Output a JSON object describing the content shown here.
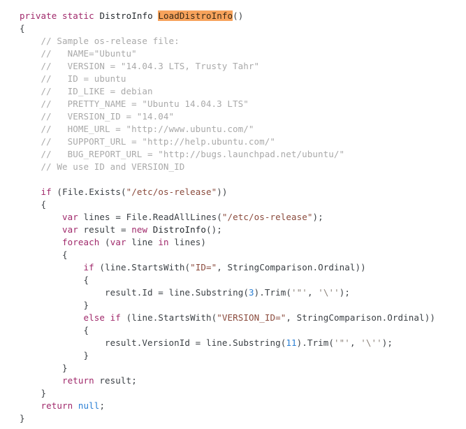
{
  "editor": {
    "language": "csharp",
    "background_color": "#ffffff",
    "highlight_color": "#f7a35c",
    "keyword_color": "#a0296b",
    "string_color": "#8a4a3c",
    "number_color": "#2a7fd4",
    "comment_color": "#a9a9a9",
    "text_color": "#3b4045",
    "search_highlight_term": "LoadDistroInfo"
  },
  "code": {
    "lines": [
      {
        "id": "l1",
        "indent": 0,
        "tokens": [
          {
            "t": "kw",
            "v": "private"
          },
          {
            "t": "plain",
            "v": " "
          },
          {
            "t": "kw",
            "v": "static"
          },
          {
            "t": "plain",
            "v": " "
          },
          {
            "t": "type",
            "v": "DistroInfo"
          },
          {
            "t": "plain",
            "v": " "
          },
          {
            "t": "hl",
            "v": "LoadDistroInfo"
          },
          {
            "t": "punc",
            "v": "()"
          }
        ]
      },
      {
        "id": "l2",
        "indent": 0,
        "tokens": [
          {
            "t": "punc",
            "v": "{"
          }
        ]
      },
      {
        "id": "l3",
        "indent": 1,
        "tokens": [
          {
            "t": "cmt",
            "v": "// Sample os-release file:"
          }
        ]
      },
      {
        "id": "l4",
        "indent": 1,
        "tokens": [
          {
            "t": "cmt",
            "v": "//   NAME=\"Ubuntu\""
          }
        ]
      },
      {
        "id": "l5",
        "indent": 1,
        "tokens": [
          {
            "t": "cmt",
            "v": "//   VERSION = \"14.04.3 LTS, Trusty Tahr\""
          }
        ]
      },
      {
        "id": "l6",
        "indent": 1,
        "tokens": [
          {
            "t": "cmt",
            "v": "//   ID = ubuntu"
          }
        ]
      },
      {
        "id": "l7",
        "indent": 1,
        "tokens": [
          {
            "t": "cmt",
            "v": "//   ID_LIKE = debian"
          }
        ]
      },
      {
        "id": "l8",
        "indent": 1,
        "tokens": [
          {
            "t": "cmt",
            "v": "//   PRETTY_NAME = \"Ubuntu 14.04.3 LTS\""
          }
        ]
      },
      {
        "id": "l9",
        "indent": 1,
        "tokens": [
          {
            "t": "cmt",
            "v": "//   VERSION_ID = \"14.04\""
          }
        ]
      },
      {
        "id": "l10",
        "indent": 1,
        "tokens": [
          {
            "t": "cmt",
            "v": "//   HOME_URL = \"http://www.ubuntu.com/\""
          }
        ]
      },
      {
        "id": "l11",
        "indent": 1,
        "tokens": [
          {
            "t": "cmt",
            "v": "//   SUPPORT_URL = \"http://help.ubuntu.com/\""
          }
        ]
      },
      {
        "id": "l12",
        "indent": 1,
        "tokens": [
          {
            "t": "cmt",
            "v": "//   BUG_REPORT_URL = \"http://bugs.launchpad.net/ubuntu/\""
          }
        ]
      },
      {
        "id": "l13",
        "indent": 1,
        "tokens": [
          {
            "t": "cmt",
            "v": "// We use ID and VERSION_ID"
          }
        ]
      },
      {
        "id": "l14",
        "indent": 0,
        "tokens": []
      },
      {
        "id": "l15",
        "indent": 1,
        "tokens": [
          {
            "t": "kw",
            "v": "if"
          },
          {
            "t": "plain",
            "v": " "
          },
          {
            "t": "punc",
            "v": "("
          },
          {
            "t": "ident",
            "v": "File.Exists"
          },
          {
            "t": "punc",
            "v": "("
          },
          {
            "t": "str",
            "v": "\"/etc/os-release\""
          },
          {
            "t": "punc",
            "v": "))"
          }
        ]
      },
      {
        "id": "l16",
        "indent": 1,
        "tokens": [
          {
            "t": "punc",
            "v": "{"
          }
        ]
      },
      {
        "id": "l17",
        "indent": 2,
        "tokens": [
          {
            "t": "kw",
            "v": "var"
          },
          {
            "t": "plain",
            "v": " "
          },
          {
            "t": "ident",
            "v": "lines"
          },
          {
            "t": "plain",
            "v": " "
          },
          {
            "t": "punc",
            "v": "="
          },
          {
            "t": "plain",
            "v": " "
          },
          {
            "t": "ident",
            "v": "File.ReadAllLines"
          },
          {
            "t": "punc",
            "v": "("
          },
          {
            "t": "str",
            "v": "\"/etc/os-release\""
          },
          {
            "t": "punc",
            "v": ");"
          }
        ]
      },
      {
        "id": "l18",
        "indent": 2,
        "tokens": [
          {
            "t": "kw",
            "v": "var"
          },
          {
            "t": "plain",
            "v": " "
          },
          {
            "t": "ident",
            "v": "result"
          },
          {
            "t": "plain",
            "v": " "
          },
          {
            "t": "punc",
            "v": "="
          },
          {
            "t": "plain",
            "v": " "
          },
          {
            "t": "kw",
            "v": "new"
          },
          {
            "t": "plain",
            "v": " "
          },
          {
            "t": "type",
            "v": "DistroInfo"
          },
          {
            "t": "punc",
            "v": "();"
          }
        ]
      },
      {
        "id": "l19",
        "indent": 2,
        "tokens": [
          {
            "t": "kw",
            "v": "foreach"
          },
          {
            "t": "plain",
            "v": " "
          },
          {
            "t": "punc",
            "v": "("
          },
          {
            "t": "kw",
            "v": "var"
          },
          {
            "t": "plain",
            "v": " "
          },
          {
            "t": "ident",
            "v": "line"
          },
          {
            "t": "plain",
            "v": " "
          },
          {
            "t": "kw",
            "v": "in"
          },
          {
            "t": "plain",
            "v": " "
          },
          {
            "t": "ident",
            "v": "lines"
          },
          {
            "t": "punc",
            "v": ")"
          }
        ]
      },
      {
        "id": "l20",
        "indent": 2,
        "tokens": [
          {
            "t": "punc",
            "v": "{"
          }
        ]
      },
      {
        "id": "l21",
        "indent": 3,
        "tokens": [
          {
            "t": "kw",
            "v": "if"
          },
          {
            "t": "plain",
            "v": " "
          },
          {
            "t": "punc",
            "v": "("
          },
          {
            "t": "ident",
            "v": "line.StartsWith"
          },
          {
            "t": "punc",
            "v": "("
          },
          {
            "t": "str",
            "v": "\"ID=\""
          },
          {
            "t": "punc",
            "v": ","
          },
          {
            "t": "plain",
            "v": " "
          },
          {
            "t": "ident",
            "v": "StringComparison.Ordinal"
          },
          {
            "t": "punc",
            "v": "))"
          }
        ]
      },
      {
        "id": "l22",
        "indent": 3,
        "tokens": [
          {
            "t": "punc",
            "v": "{"
          }
        ]
      },
      {
        "id": "l23",
        "indent": 4,
        "tokens": [
          {
            "t": "ident",
            "v": "result.Id"
          },
          {
            "t": "plain",
            "v": " "
          },
          {
            "t": "punc",
            "v": "="
          },
          {
            "t": "plain",
            "v": " "
          },
          {
            "t": "ident",
            "v": "line.Substring"
          },
          {
            "t": "punc",
            "v": "("
          },
          {
            "t": "num",
            "v": "3"
          },
          {
            "t": "punc",
            "v": ")."
          },
          {
            "t": "ident",
            "v": "Trim"
          },
          {
            "t": "punc",
            "v": "("
          },
          {
            "t": "chr",
            "v": "'\"'"
          },
          {
            "t": "punc",
            "v": ","
          },
          {
            "t": "plain",
            "v": " "
          },
          {
            "t": "chr",
            "v": "'\\''"
          },
          {
            "t": "punc",
            "v": ");"
          }
        ]
      },
      {
        "id": "l24",
        "indent": 3,
        "tokens": [
          {
            "t": "punc",
            "v": "}"
          }
        ]
      },
      {
        "id": "l25",
        "indent": 3,
        "tokens": [
          {
            "t": "kw",
            "v": "else"
          },
          {
            "t": "plain",
            "v": " "
          },
          {
            "t": "kw",
            "v": "if"
          },
          {
            "t": "plain",
            "v": " "
          },
          {
            "t": "punc",
            "v": "("
          },
          {
            "t": "ident",
            "v": "line.StartsWith"
          },
          {
            "t": "punc",
            "v": "("
          },
          {
            "t": "str",
            "v": "\"VERSION_ID=\""
          },
          {
            "t": "punc",
            "v": ","
          },
          {
            "t": "plain",
            "v": " "
          },
          {
            "t": "ident",
            "v": "StringComparison.Ordinal"
          },
          {
            "t": "punc",
            "v": "))"
          }
        ]
      },
      {
        "id": "l26",
        "indent": 3,
        "tokens": [
          {
            "t": "punc",
            "v": "{"
          }
        ]
      },
      {
        "id": "l27",
        "indent": 4,
        "tokens": [
          {
            "t": "ident",
            "v": "result.VersionId"
          },
          {
            "t": "plain",
            "v": " "
          },
          {
            "t": "punc",
            "v": "="
          },
          {
            "t": "plain",
            "v": " "
          },
          {
            "t": "ident",
            "v": "line.Substring"
          },
          {
            "t": "punc",
            "v": "("
          },
          {
            "t": "num",
            "v": "11"
          },
          {
            "t": "punc",
            "v": ")."
          },
          {
            "t": "ident",
            "v": "Trim"
          },
          {
            "t": "punc",
            "v": "("
          },
          {
            "t": "chr",
            "v": "'\"'"
          },
          {
            "t": "punc",
            "v": ","
          },
          {
            "t": "plain",
            "v": " "
          },
          {
            "t": "chr",
            "v": "'\\''"
          },
          {
            "t": "punc",
            "v": ");"
          }
        ]
      },
      {
        "id": "l28",
        "indent": 3,
        "tokens": [
          {
            "t": "punc",
            "v": "}"
          }
        ]
      },
      {
        "id": "l29",
        "indent": 2,
        "tokens": [
          {
            "t": "punc",
            "v": "}"
          }
        ]
      },
      {
        "id": "l30",
        "indent": 2,
        "tokens": [
          {
            "t": "kw",
            "v": "return"
          },
          {
            "t": "plain",
            "v": " "
          },
          {
            "t": "ident",
            "v": "result"
          },
          {
            "t": "punc",
            "v": ";"
          }
        ]
      },
      {
        "id": "l31",
        "indent": 1,
        "tokens": [
          {
            "t": "punc",
            "v": "}"
          }
        ]
      },
      {
        "id": "l32",
        "indent": 1,
        "tokens": [
          {
            "t": "kw",
            "v": "return"
          },
          {
            "t": "plain",
            "v": " "
          },
          {
            "t": "num",
            "v": "null"
          },
          {
            "t": "punc",
            "v": ";"
          }
        ]
      },
      {
        "id": "l33",
        "indent": 0,
        "tokens": [
          {
            "t": "punc",
            "v": "}"
          }
        ]
      }
    ]
  }
}
